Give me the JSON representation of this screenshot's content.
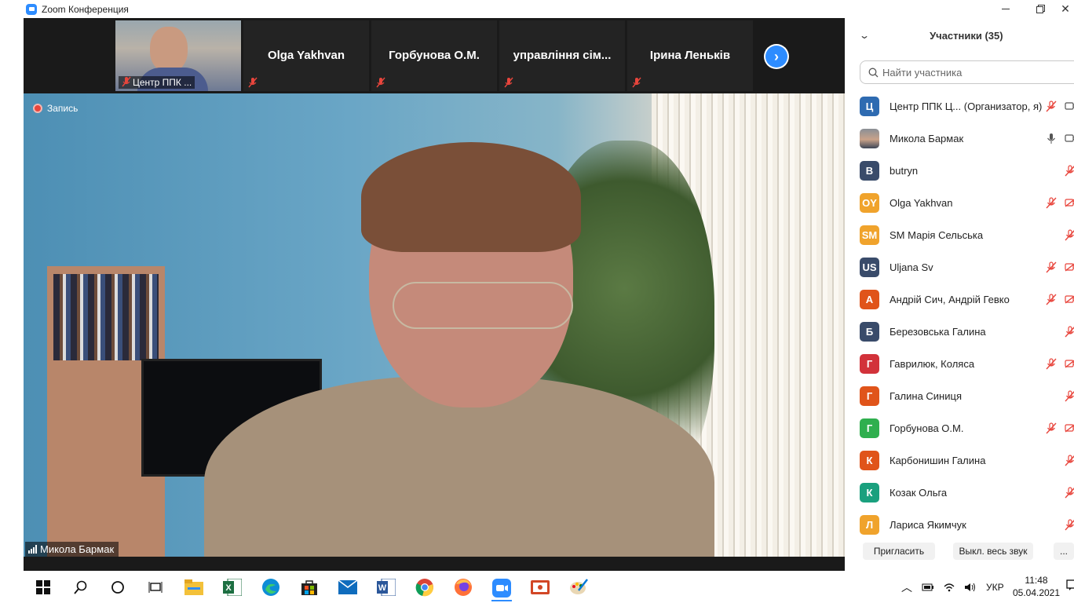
{
  "window": {
    "title": "Zoom Конференция",
    "accent": "#2D8CFF"
  },
  "thumbnails": [
    {
      "name": "Центр ППК ...",
      "has_video": true
    },
    {
      "name": "Olga Yakhvan",
      "has_video": false
    },
    {
      "name": "Горбунова О.М.",
      "has_video": false
    },
    {
      "name": "управління сім...",
      "has_video": false
    },
    {
      "name": "Ірина Леньків",
      "has_video": false
    }
  ],
  "main_video": {
    "recording_label": "Запись",
    "speaker_name": "Микола Бармак"
  },
  "participants_panel": {
    "title": "Участники (35)",
    "search_placeholder": "Найти участника",
    "participants": [
      {
        "initials": "Ц",
        "name": "Центр ППК Ц... (Организатор, я)",
        "color": "#2E6BB1",
        "mic": "muted",
        "video": "on"
      },
      {
        "initials": "",
        "name": "Микола Бармак",
        "color": "",
        "mic": "on",
        "video": "on"
      },
      {
        "initials": "B",
        "name": "butryn",
        "color": "#394B6A",
        "mic": "muted",
        "video": "none"
      },
      {
        "initials": "OY",
        "name": "Olga Yakhvan",
        "color": "#F0A32C",
        "mic": "muted",
        "video": "off"
      },
      {
        "initials": "SM",
        "name": "SM Марія Сельська",
        "color": "#F0A32C",
        "mic": "muted",
        "video": "none"
      },
      {
        "initials": "US",
        "name": "Uljana Sv",
        "color": "#394B6A",
        "mic": "muted",
        "video": "off"
      },
      {
        "initials": "А",
        "name": "Андрій Сич, Андрій Гевко",
        "color": "#E0541A",
        "mic": "muted",
        "video": "off"
      },
      {
        "initials": "Б",
        "name": "Березовська Галина",
        "color": "#394B6A",
        "mic": "muted",
        "video": "none"
      },
      {
        "initials": "Г",
        "name": "Гаврилюк, Коляса",
        "color": "#D2323A",
        "mic": "muted",
        "video": "off"
      },
      {
        "initials": "Г",
        "name": "Галина Синиця",
        "color": "#E0541A",
        "mic": "muted",
        "video": "none"
      },
      {
        "initials": "Г",
        "name": "Горбунова О.М.",
        "color": "#2FAF4E",
        "mic": "muted",
        "video": "off"
      },
      {
        "initials": "К",
        "name": "Карбонишин Галина",
        "color": "#E0541A",
        "mic": "muted",
        "video": "none"
      },
      {
        "initials": "К",
        "name": "Козак Ольга",
        "color": "#1AA07E",
        "mic": "muted",
        "video": "none"
      },
      {
        "initials": "Л",
        "name": "Лариса Якимчук",
        "color": "#F0A32C",
        "mic": "muted",
        "video": "none"
      }
    ],
    "invite_label": "Пригласить",
    "mute_all_label": "Выкл. весь звук",
    "more_label": "..."
  },
  "taskbar": {
    "apps": [
      "start-icon",
      "search-icon",
      "cortana-icon",
      "task-view-icon",
      "file-explorer-icon",
      "excel-icon",
      "edge-icon",
      "store-icon",
      "mail-icon",
      "word-icon",
      "chrome-icon",
      "firefox-icon",
      "zoom-icon",
      "presentation-icon",
      "paint-icon"
    ],
    "language": "УКР",
    "time": "11:48",
    "date": "05.04.2021"
  }
}
